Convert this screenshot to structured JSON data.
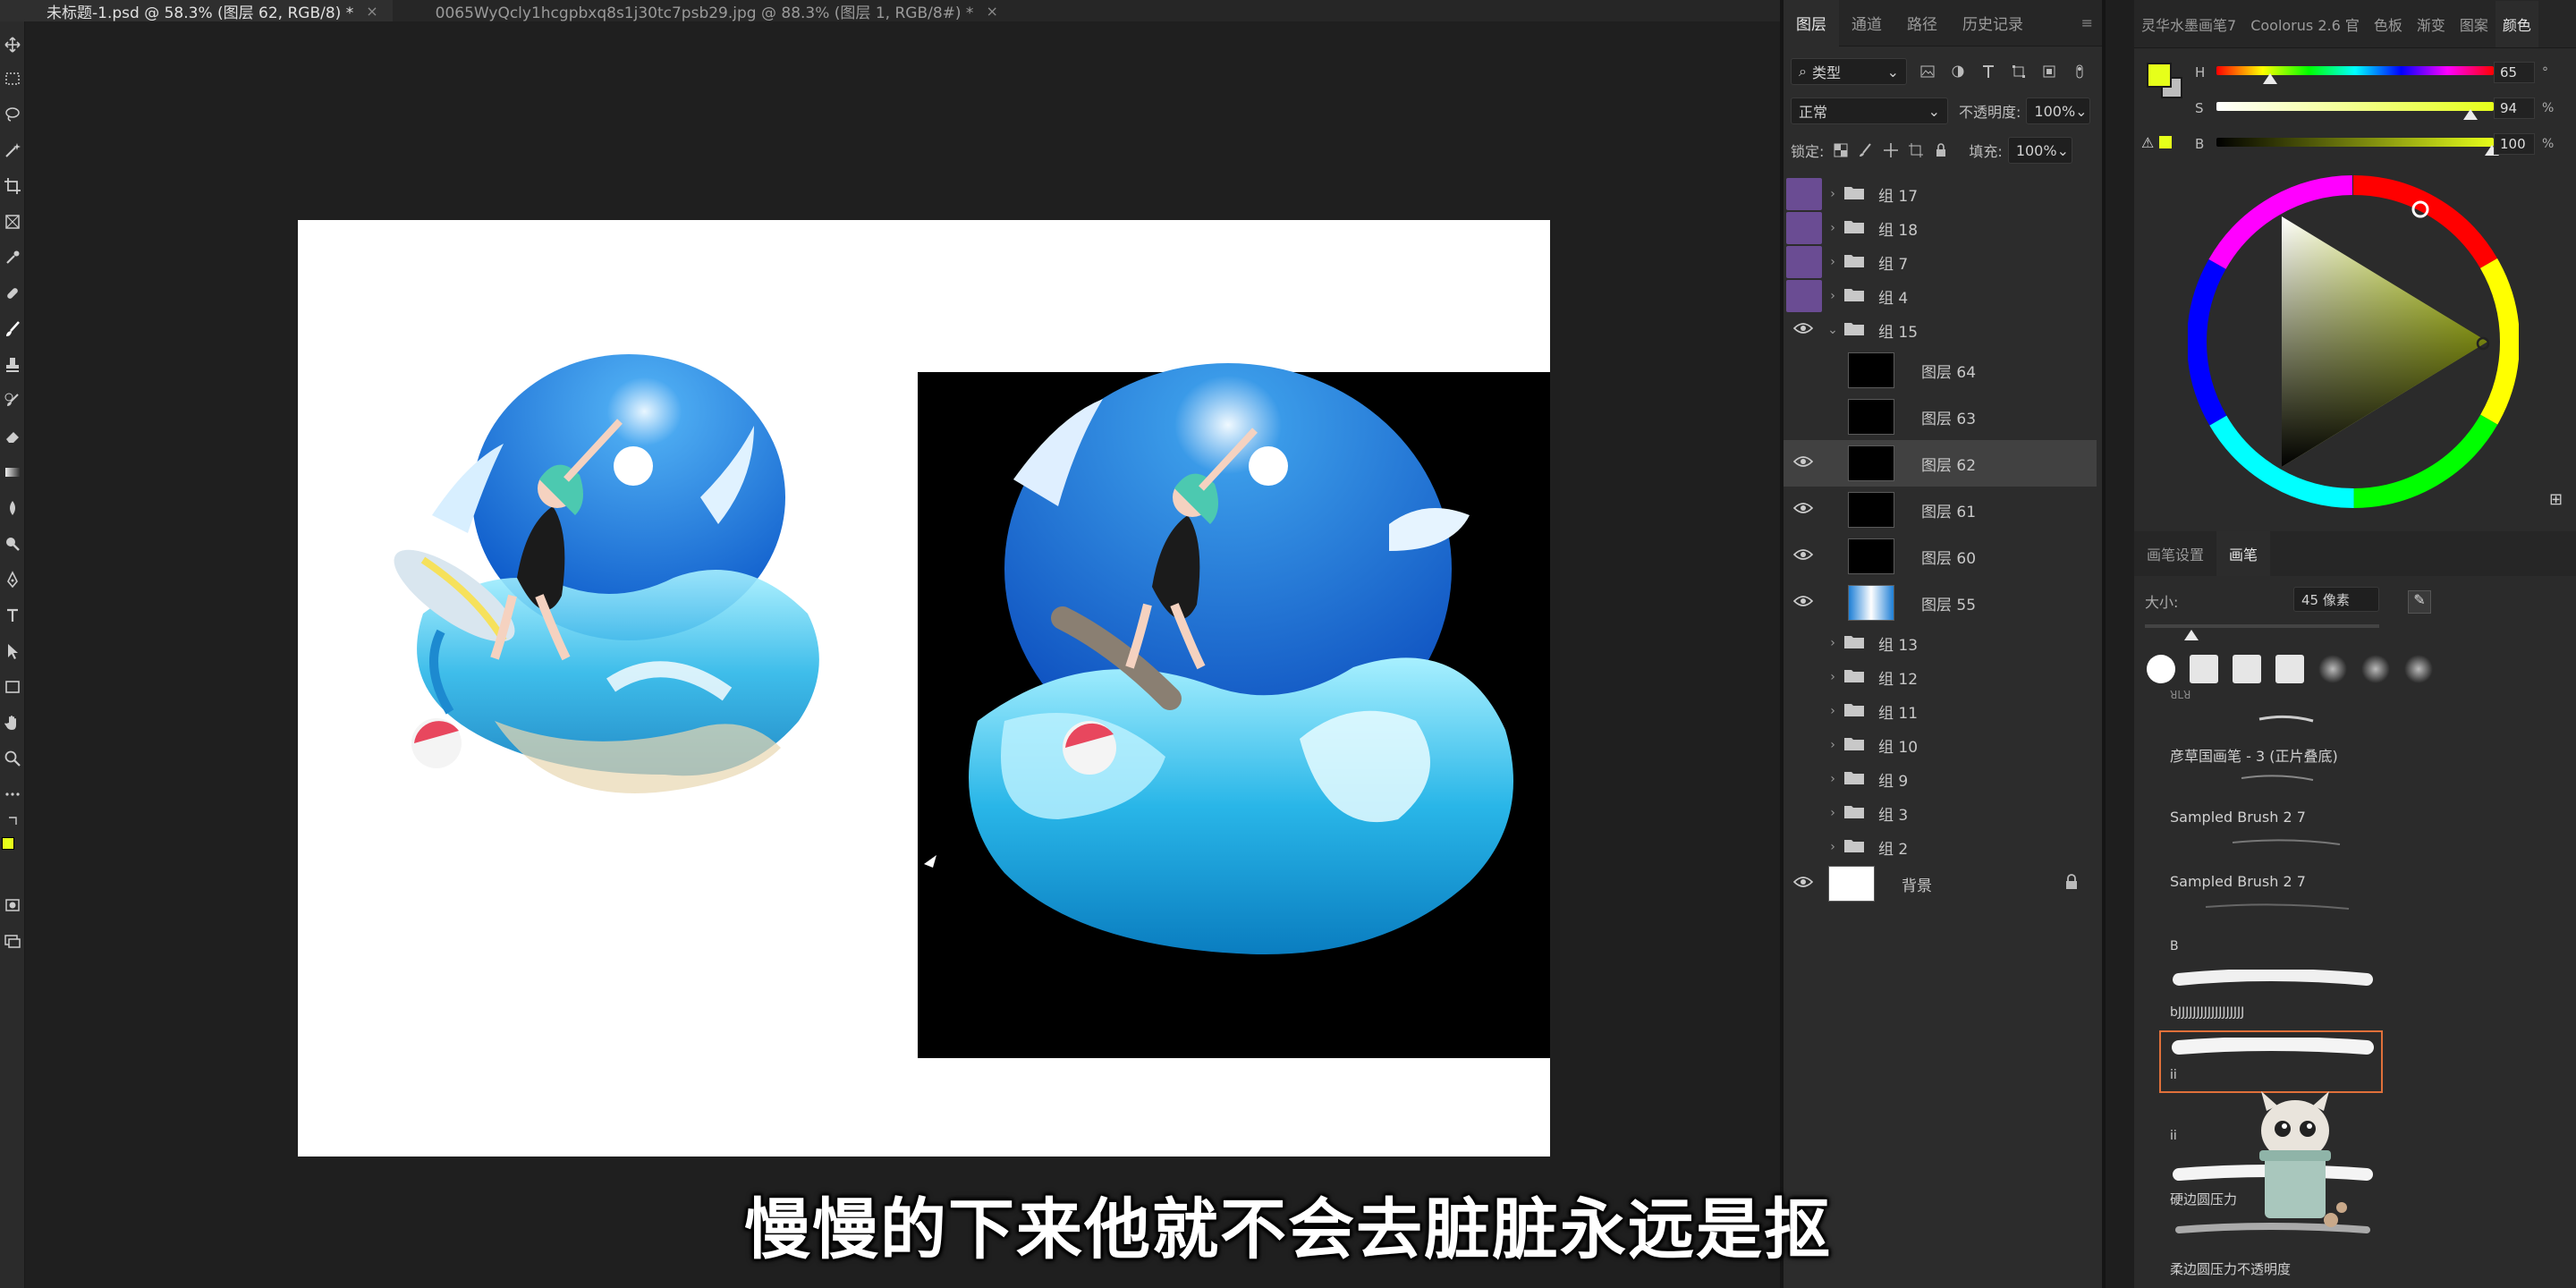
{
  "doc_tabs": [
    {
      "label": "未标题-1.psd @ 58.3% (图层 62, RGB/8) *",
      "active": true
    },
    {
      "label": "0065WyQcly1hcgpbxq8s1j30tc7psb29.jpg @ 88.3% (图层 1, RGB/8#) *",
      "active": false
    }
  ],
  "tab_close": "×",
  "layers_panel": {
    "tabs": [
      "图层",
      "通道",
      "路径",
      "历史记录"
    ],
    "filter_label": "类型",
    "blend_mode": "正常",
    "opacity_label": "不透明度:",
    "opacity_value": "100%",
    "lock_label": "锁定:",
    "fill_label": "填充:",
    "fill_value": "100%",
    "layers": [
      {
        "name": "组 17",
        "type": "group",
        "visible": false,
        "purple": true
      },
      {
        "name": "组 18",
        "type": "group",
        "visible": false,
        "purple": true
      },
      {
        "name": "组 7",
        "type": "group",
        "visible": false,
        "purple": true
      },
      {
        "name": "组 4",
        "type": "group",
        "visible": false,
        "purple": true
      },
      {
        "name": "组 15",
        "type": "group-open",
        "visible": true
      },
      {
        "name": "图层 64",
        "type": "layer",
        "visible": false
      },
      {
        "name": "图层 63",
        "type": "layer",
        "visible": false
      },
      {
        "name": "图层 62",
        "type": "layer",
        "visible": true,
        "selected": true
      },
      {
        "name": "图层 61",
        "type": "layer",
        "visible": true
      },
      {
        "name": "图层 60",
        "type": "layer",
        "visible": true
      },
      {
        "name": "图层 55",
        "type": "layer",
        "visible": true
      },
      {
        "name": "组 13",
        "type": "group",
        "visible": false
      },
      {
        "name": "组 12",
        "type": "group",
        "visible": false
      },
      {
        "name": "组 11",
        "type": "group",
        "visible": false
      },
      {
        "name": "组 10",
        "type": "group",
        "visible": false
      },
      {
        "name": "组 9",
        "type": "group",
        "visible": false
      },
      {
        "name": "组 3",
        "type": "group",
        "visible": false
      },
      {
        "name": "组 2",
        "type": "group",
        "visible": false
      },
      {
        "name": "背景",
        "type": "background",
        "visible": true
      }
    ]
  },
  "color_panel": {
    "tabs": [
      "灵华水墨画笔7",
      "Coolorus 2.6 官",
      "色板",
      "渐变",
      "图案",
      "颜色"
    ],
    "foreground_color": "#e6ff1a",
    "h_label": "H",
    "h_value": "65",
    "h_unit": "°",
    "s_label": "S",
    "s_value": "94",
    "s_unit": "%",
    "b_label": "B",
    "b_value": "100",
    "b_unit": "%"
  },
  "brush_panel": {
    "tabs": [
      "画笔设置",
      "画笔"
    ],
    "size_label": "大小:",
    "size_value": "45 像素",
    "brushes": [
      "彦草国画笔 - 3 (正片叠底)",
      "Sampled Brush 2 7",
      "Sampled Brush 2 7",
      "B",
      "bJJJJJJJJJJJJJJJJJJ",
      "ii",
      "ii",
      "硬边圆压力",
      "柔边圆压力不透明度"
    ],
    "partial_top_label": "ꓤꓡꓤ"
  },
  "subtitle": "慢慢的下来他就不会去脏脏永远是抠",
  "colors": {
    "panel_bg": "#2c2c2c",
    "canvas_bg": "#1f1f1f",
    "selection_purple": "#6a4c93",
    "brush_highlight": "#e0703a"
  }
}
